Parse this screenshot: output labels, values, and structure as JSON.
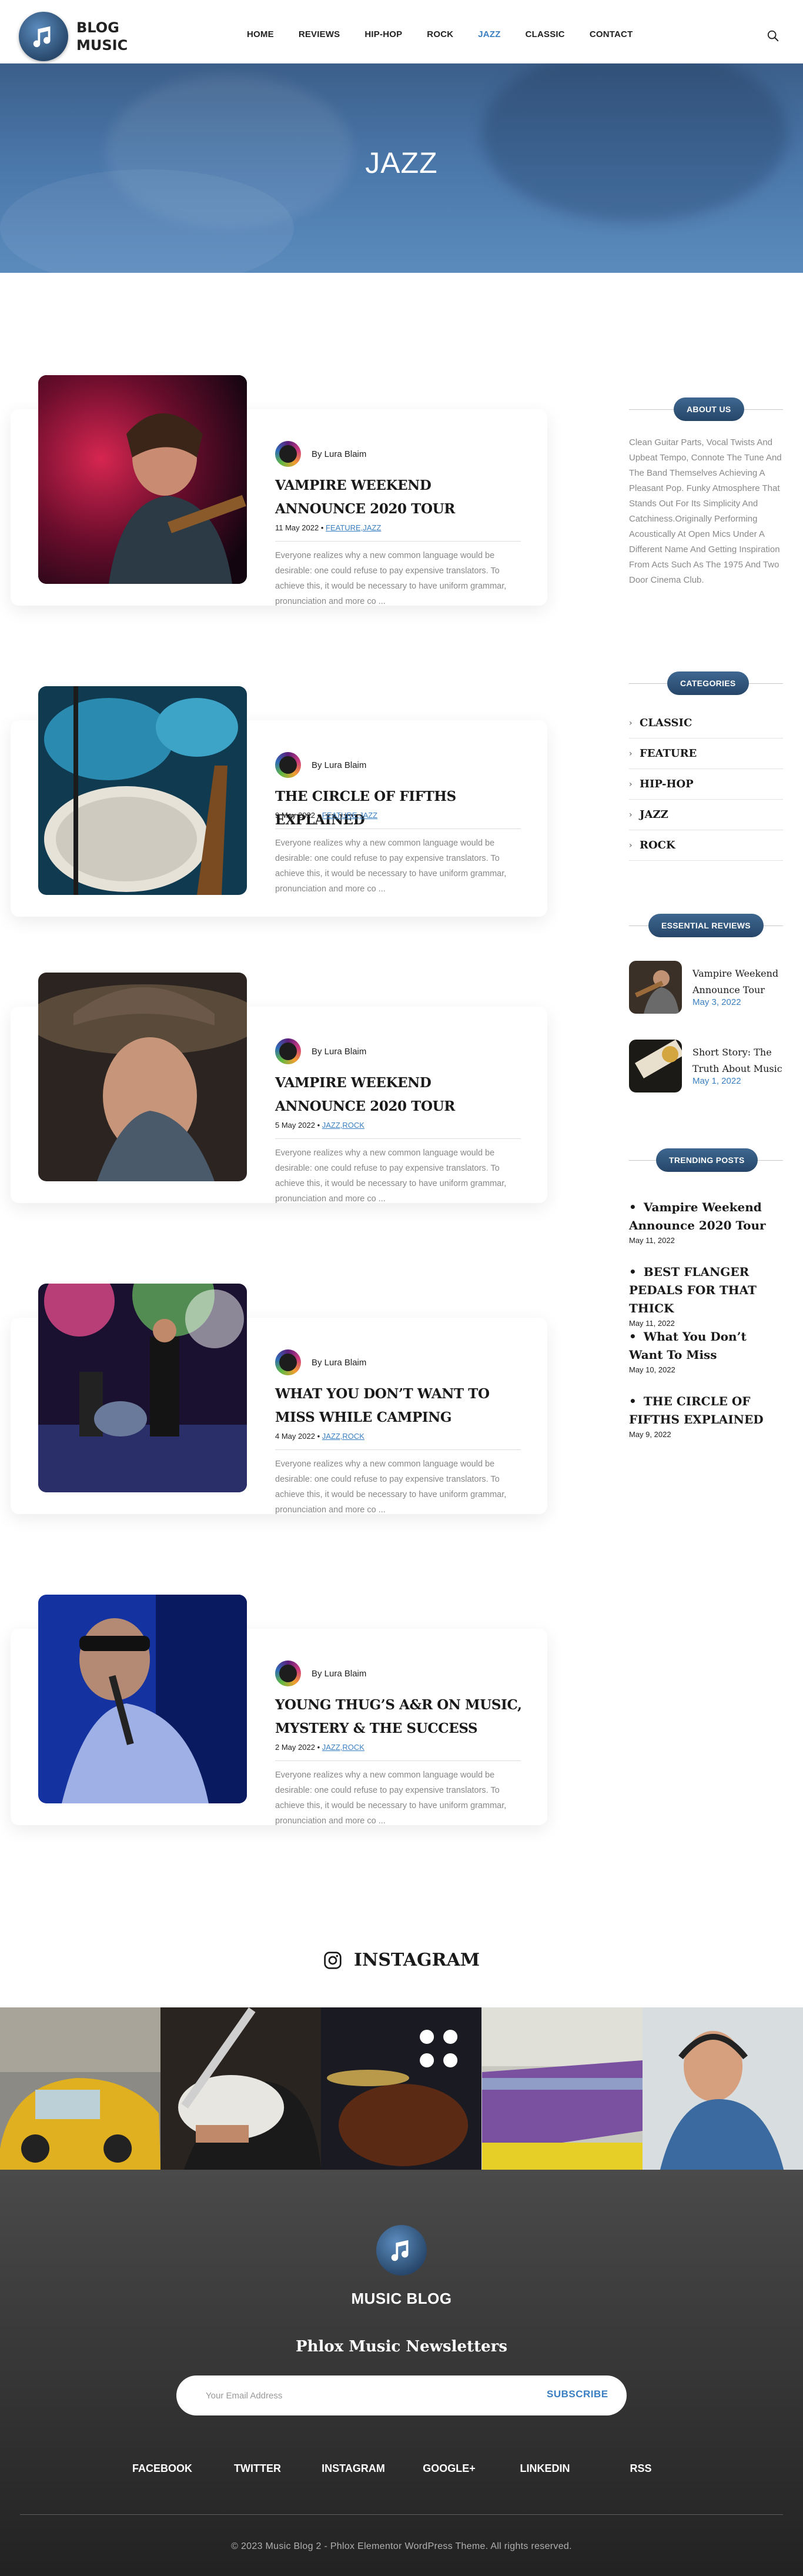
{
  "header": {
    "logo_line1": "BLOG",
    "logo_line2": "MUSIC",
    "nav": [
      "HOME",
      "REVIEWS",
      "HIP-HOP",
      "ROCK",
      "JAZZ",
      "CLASSIC",
      "CONTACT"
    ],
    "active_nav": "JAZZ",
    "icon": "search-icon"
  },
  "hero": {
    "title": "JAZZ"
  },
  "posts": [
    {
      "author": "By Lura Blaim",
      "title": "VAMPIRE WEEKEND ANNOUNCE 2020 TOUR",
      "date": "11 May 2022",
      "sep": "•",
      "tags": "FEATURE,JAZZ",
      "excerpt": "Everyone realizes why a new common language would be desirable: one could refuse to pay expensive translators. To achieve this, it would be necessary to have uniform grammar, pronunciation and more co ..."
    },
    {
      "author": "By Lura Blaim",
      "title": "THE CIRCLE OF FIFTHS EXPLAINED",
      "date": "9 May 2022",
      "sep": "•",
      "tags": "FEATURE,JAZZ",
      "excerpt": "Everyone realizes why a new common language would be desirable: one could refuse to pay expensive translators. To achieve this, it would be necessary to have uniform grammar, pronunciation and more co ..."
    },
    {
      "author": "By Lura Blaim",
      "title": "VAMPIRE WEEKEND ANNOUNCE 2020 TOUR",
      "date": "5 May 2022",
      "sep": "•",
      "tags": "JAZZ,ROCK",
      "excerpt": "Everyone realizes why a new common language would be desirable: one could refuse to pay expensive translators. To achieve this, it would be necessary to have uniform grammar, pronunciation and more co ..."
    },
    {
      "author": "By Lura Blaim",
      "title": "WHAT YOU DON’T WANT TO MISS WHILE CAMPING",
      "date": "4 May 2022",
      "sep": "•",
      "tags": "JAZZ,ROCK",
      "excerpt": "Everyone realizes why a new common language would be desirable: one could refuse to pay expensive translators. To achieve this, it would be necessary to have uniform grammar, pronunciation and more co ..."
    },
    {
      "author": "By Lura Blaim",
      "title": "YOUNG THUG’S A&R ON MUSIC, MYSTERY & THE SUCCESS",
      "date": "2 May 2022",
      "sep": "•",
      "tags": "JAZZ,ROCK",
      "excerpt": "Everyone realizes why a new common language would be desirable: one could refuse to pay expensive translators. To achieve this, it would be necessary to have uniform grammar, pronunciation and more co ..."
    }
  ],
  "sidebar": {
    "about": {
      "heading": "ABOUT US",
      "text": "Clean Guitar Parts, Vocal Twists And Upbeat Tempo, Connote The Tune And The Band Themselves Achieving A Pleasant Pop. Funky Atmosphere That Stands Out For Its Simplicity And Catchiness.Originally Performing Acoustically At Open Mics Under A Different Name And Getting Inspiration From Acts Such As The 1975 And Two Door Cinema Club."
    },
    "categories": {
      "heading": "CATEGORIES",
      "items": [
        "CLASSIC",
        "FEATURE",
        "HIP-HOP",
        "JAZZ",
        "ROCK"
      ]
    },
    "reviews": {
      "heading": "ESSENTIAL REVIEWS",
      "items": [
        {
          "title": "Vampire Weekend Announce Tour",
          "date": "May 3, 2022"
        },
        {
          "title": "Short Story: The Truth About Music",
          "date": "May 1, 2022"
        }
      ]
    },
    "trending": {
      "heading": "TRENDING POSTS",
      "items": [
        {
          "title": "Vampire Weekend Announce 2020 Tour",
          "date": "May 11, 2022"
        },
        {
          "title": "BEST FLANGER PEDALS FOR THAT THICK",
          "date": "May 11, 2022"
        },
        {
          "title": "What You Don’t Want To Miss",
          "date": "May 10, 2022"
        },
        {
          "title": "THE CIRCLE OF FIFTHS EXPLAINED",
          "date": "May 9, 2022"
        }
      ]
    }
  },
  "instagram": {
    "heading": "INSTAGRAM",
    "icon": "instagram-icon"
  },
  "footer": {
    "brand": "MUSIC BLOG",
    "newsletter_title": "Phlox Music Newsletters",
    "email_placeholder": "Your Email Address",
    "subscribe_label": "SUBSCRIBE",
    "social": [
      "FACEBOOK",
      "TWITTER",
      "INSTAGRAM",
      "GOOGLE+",
      "LINKEDIN",
      "RSS"
    ],
    "copyright": "© 2023 Music Blog 2 - Phlox Elementor WordPress Theme. All rights reserved."
  },
  "colors": {
    "accent": "#3a7fc1",
    "pill": "#2f5378",
    "footer_bg": "#3a3a3a"
  }
}
